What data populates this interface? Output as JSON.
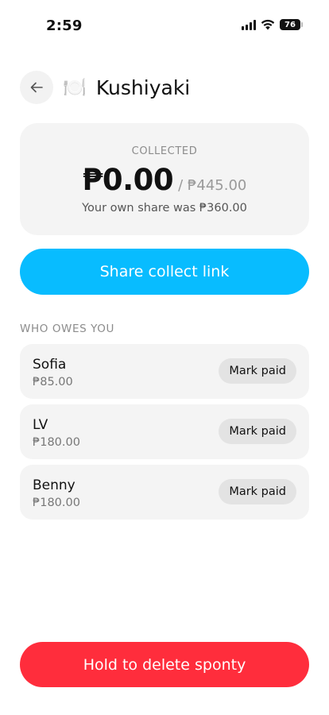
{
  "status_bar": {
    "time": "2:59",
    "battery": "76",
    "icons": [
      "signal-icon",
      "wifi-icon",
      "battery-icon"
    ]
  },
  "header": {
    "back_icon": "arrow-left-icon",
    "emoji": "🍽️",
    "title": "Kushiyaki"
  },
  "summary": {
    "label": "COLLECTED",
    "collected": "₱0.00",
    "total": "/ ₱445.00",
    "own_share": "Your own share was ₱360.00"
  },
  "share_button": {
    "label": "Share collect link"
  },
  "owes_section": {
    "label": "WHO OWES YOU",
    "items": [
      {
        "name": "Sofia",
        "amount": "₱85.00",
        "action": "Mark paid"
      },
      {
        "name": "LV",
        "amount": "₱180.00",
        "action": "Mark paid"
      },
      {
        "name": "Benny",
        "amount": "₱180.00",
        "action": "Mark paid"
      }
    ]
  },
  "delete_button": {
    "label": "Hold to delete sponty"
  },
  "colors": {
    "primary": "#08bcff",
    "danger": "#ff2d3c",
    "card": "#f4f4f4",
    "muted": "#8c8c8c"
  }
}
